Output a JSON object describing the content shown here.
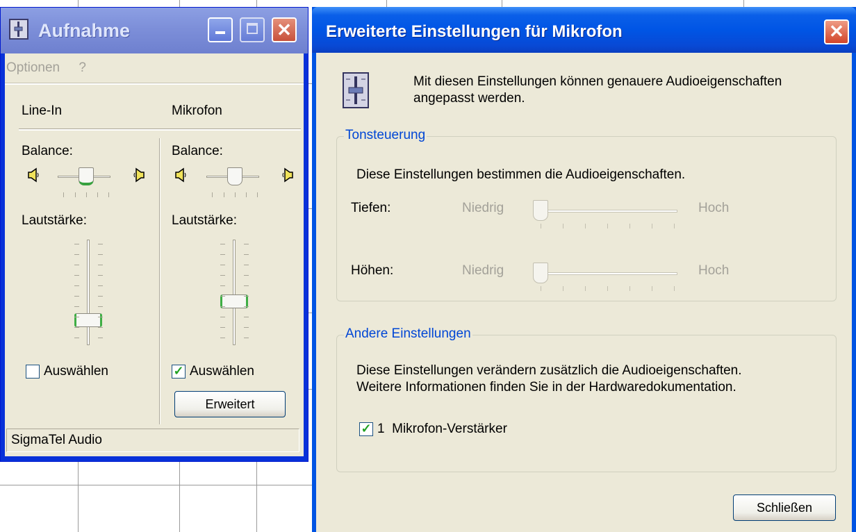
{
  "window1": {
    "title": "Aufnahme",
    "menu": [
      "Optionen",
      "?"
    ],
    "channels": [
      {
        "name": "Line-In",
        "balance_label": "Balance:",
        "volume_label": "Lautstärke:",
        "select_label": "Auswählen",
        "selected": false,
        "balance": 0.5,
        "volume": 0.2
      },
      {
        "name": "Mikrofon",
        "balance_label": "Balance:",
        "volume_label": "Lautstärke:",
        "select_label": "Auswählen",
        "selected": true,
        "balance": 0.5,
        "volume": 0.4,
        "advanced_button": "Erweitert"
      }
    ],
    "status": "SigmaTel Audio",
    "check_mark": "✓"
  },
  "window2": {
    "title": "Erweiterte Einstellungen für Mikrofon",
    "intro": "Mit diesen Einstellungen können genauere Audioeigenschaften angepasst werden.",
    "intro_line1": "Mit diesen Einstellungen können genauere Audioeigenschaften",
    "intro_line2": "angepasst werden.",
    "tone_group": {
      "title": "Tonsteuerung",
      "description": "Diese Einstellungen bestimmen die Audioeigenschaften.",
      "bass_label": "Tiefen:",
      "treble_label": "Höhen:",
      "low_label": "Niedrig",
      "high_label": "Hoch",
      "bass_value": 0,
      "treble_value": 0
    },
    "other_group": {
      "title": "Andere Einstellungen",
      "description_line1": "Diese Einstellungen verändern zusätzlich die Audioeigenschaften.",
      "description_line2": "Weitere Informationen finden Sie in der Hardwaredokumentation.",
      "mic_boost_label": "1  Mikrofon-Verstärker",
      "mic_boost_checked": true
    },
    "close_button": "Schließen"
  },
  "colors": {
    "dialog_face": "#ece9d8",
    "group_title": "#0046d5",
    "title_bar_active": "#0055e5",
    "title_bar_inactive": "#7d8fd9",
    "check_green": "#21a121",
    "thumb_green": "#37a13f"
  },
  "icons": [
    "speaker-left-icon",
    "speaker-right-icon",
    "mixer-icon",
    "close-icon",
    "minimize-icon",
    "maximize-icon"
  ]
}
